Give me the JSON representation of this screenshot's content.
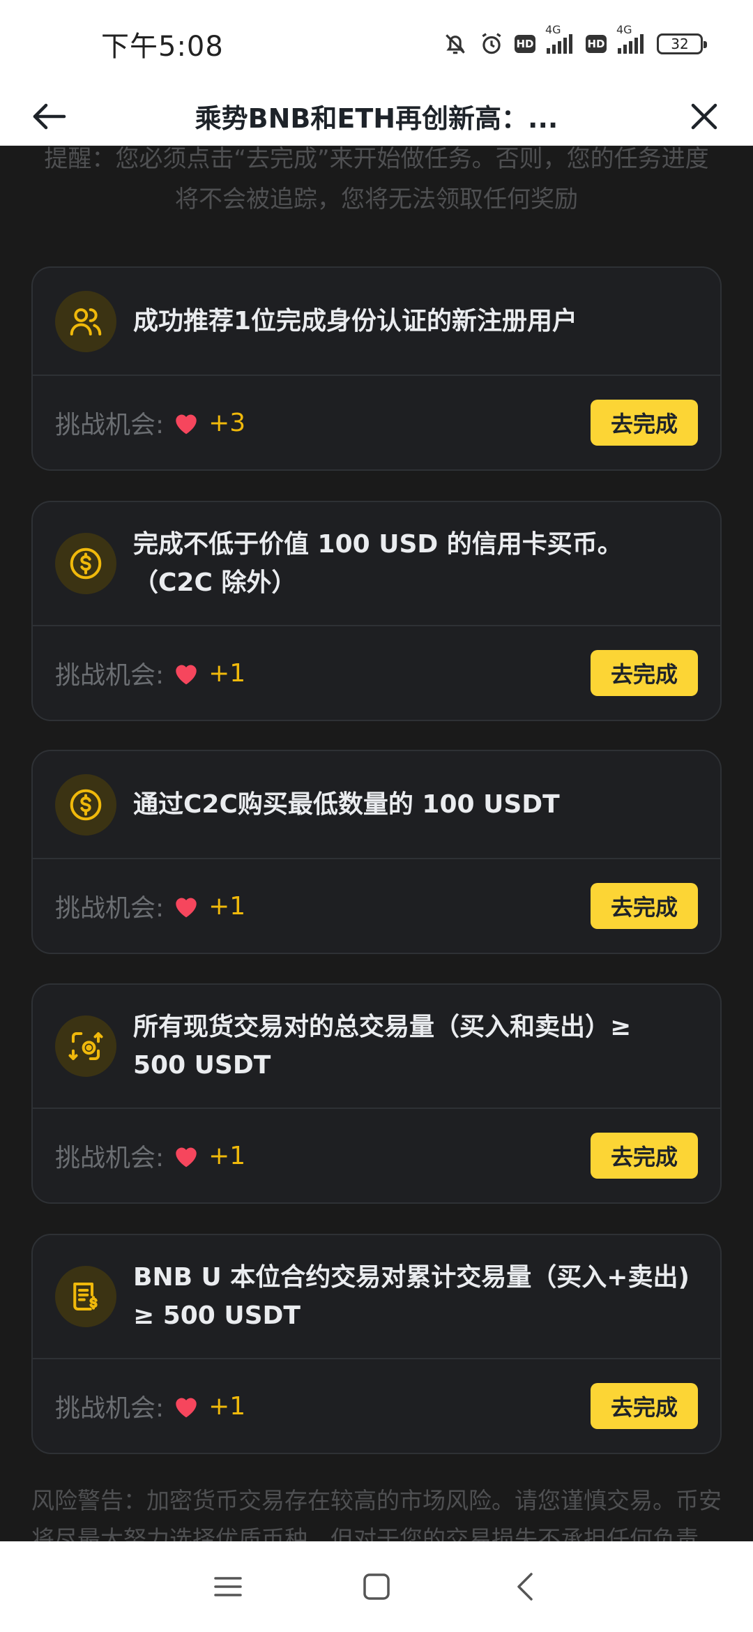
{
  "status_bar": {
    "time": "下午5:08",
    "network_1": "4G",
    "network_2": "4G",
    "hd_1": "HD",
    "hd_2": "HD",
    "battery": "32"
  },
  "nav": {
    "title": "乘势BNB和ETH再创新高：..."
  },
  "reminder": "提醒：您必须点击“去完成”来开始做任务。否则，您的任务进度将不会被追踪，您将无法领取任何奖励",
  "chance_label": "挑战机会:",
  "go_label": "去完成",
  "tasks": [
    {
      "icon": "users-icon",
      "text": "成功推荐1位完成身份认证的新注册用户",
      "count": "+3"
    },
    {
      "icon": "dollar-coin-icon",
      "text": "完成不低于价值 100 USD 的信用卡买币。（C2C 除外）",
      "count": "+1"
    },
    {
      "icon": "dollar-coin-icon",
      "text": "通过C2C购买最低数量的 100 USDT",
      "count": "+1"
    },
    {
      "icon": "exchange-icon",
      "text": "所有现货交易对的总交易量（买入和卖出）≥ 500 USDT",
      "count": "+1"
    },
    {
      "icon": "futures-doc-icon",
      "text": "BNB U 本位合约交易对累计交易量（买入+卖出) ≥ 500 USDT",
      "count": "+1"
    }
  ],
  "risk_warning": "风险警告：加密货币交易存在较高的市场风险。请您谨慎交易。币安将尽最大努力选择优质币种，但对于您的交易损失不承担任何负责。",
  "colors": {
    "accent": "#FCD535",
    "heart": "#F6465D",
    "background": "#1A1A1A"
  }
}
